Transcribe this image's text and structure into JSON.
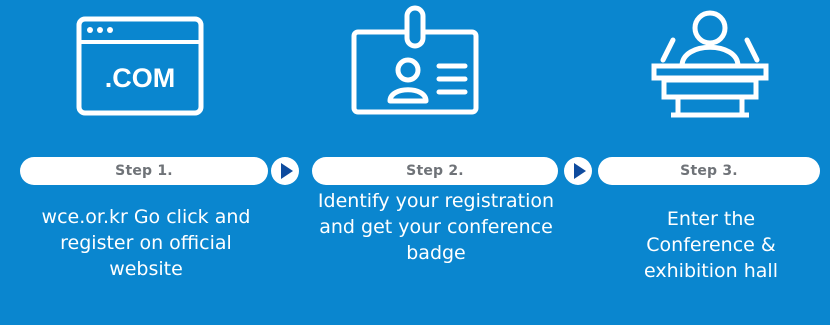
{
  "steps": [
    {
      "icon": "website-com-icon",
      "icon_text": ".COM",
      "label": "Step 1.",
      "description": "wce.or.kr Go click and register on official website"
    },
    {
      "icon": "id-badge-icon",
      "label": "Step 2.",
      "description": "Identify your registration and get your conference badge"
    },
    {
      "icon": "conference-podium-icon",
      "label": "Step 3.",
      "description": "Enter the Conference & exhibition hall"
    }
  ],
  "colors": {
    "background": "#0a86cf",
    "pill": "#ffffff",
    "pill_text": "#6f7378",
    "arrow": "#0e4b9e",
    "text": "#ffffff"
  }
}
